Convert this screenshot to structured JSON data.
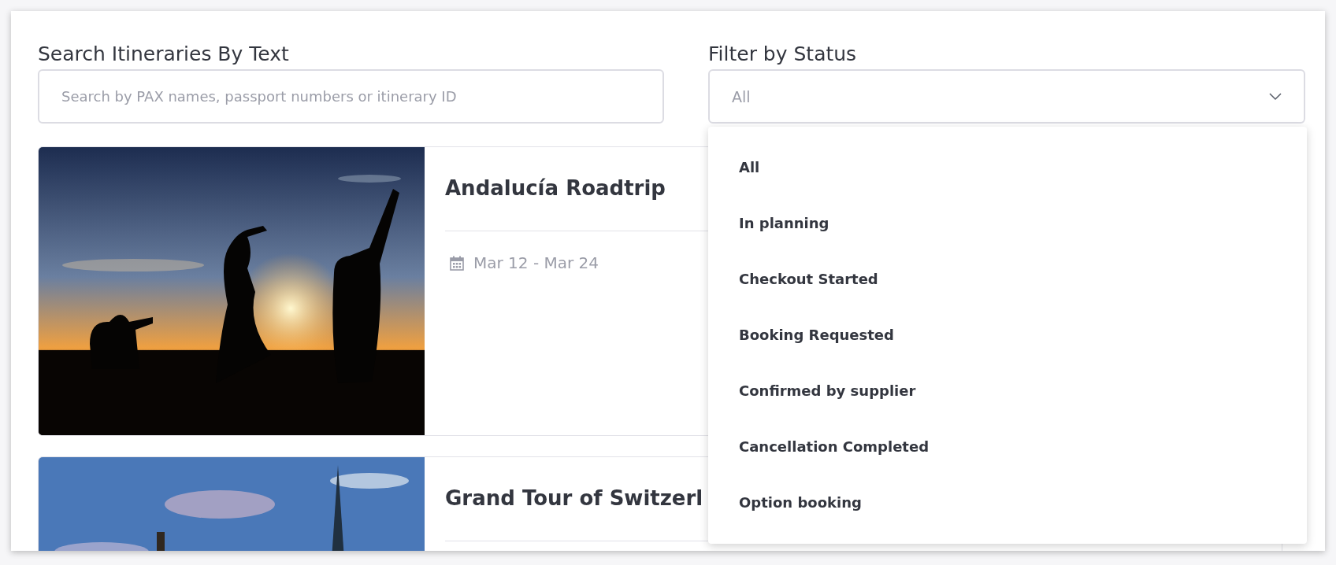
{
  "search": {
    "label": "Search Itineraries By Text",
    "placeholder": "Search by PAX names, passport numbers or itinerary ID"
  },
  "status_filter": {
    "label": "Filter by Status",
    "value": "All",
    "expanded": true,
    "options": [
      "All",
      "In planning",
      "Checkout Started",
      "Booking Requested",
      "Confirmed by supplier",
      "Cancellation Completed",
      "Option booking"
    ]
  },
  "itineraries": [
    {
      "title": "Andalucía Roadtrip",
      "dates": "Mar 12 - Mar 24"
    },
    {
      "title": "Grand Tour of Switzerl"
    }
  ]
}
